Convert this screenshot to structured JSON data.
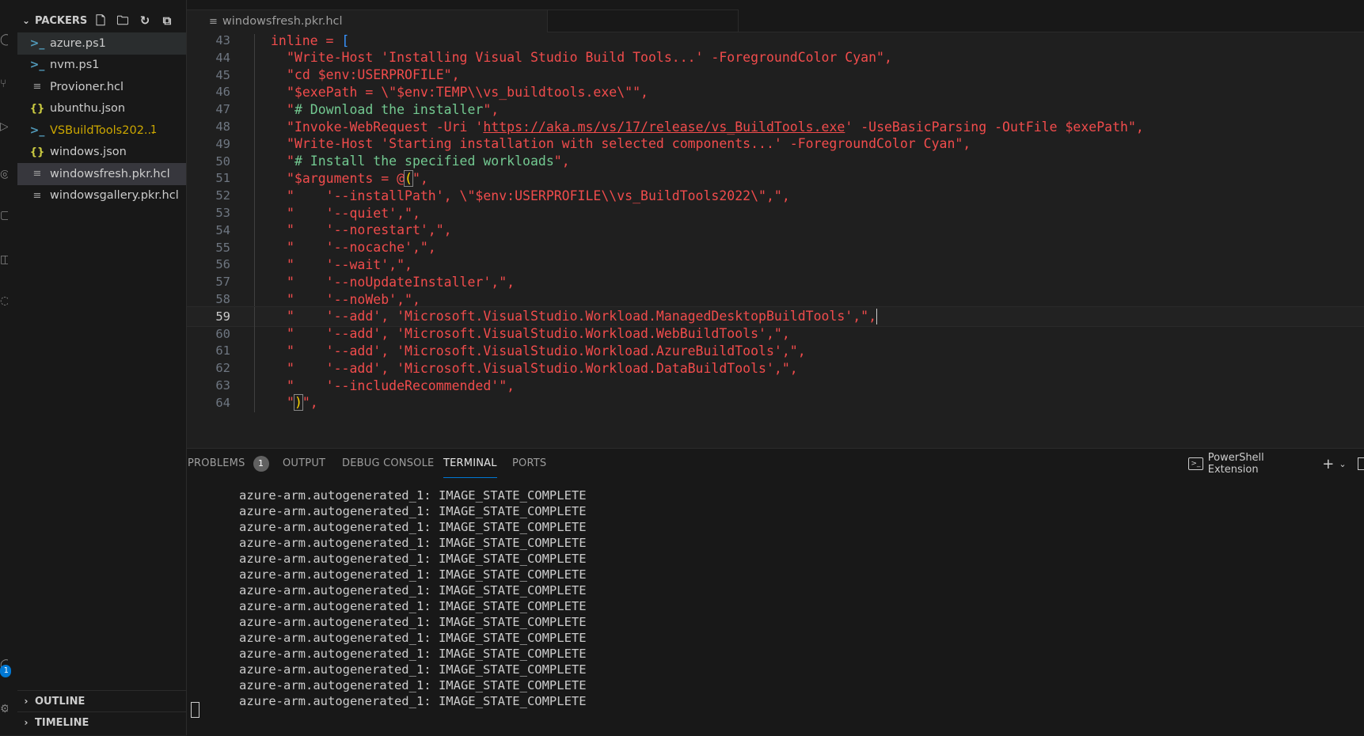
{
  "sidebar": {
    "title": "PACKERS",
    "files": [
      {
        "name": "azure.ps1",
        "type": "ps",
        "state": "active"
      },
      {
        "name": "nvm.ps1",
        "type": "ps",
        "state": ""
      },
      {
        "name": "Provioner.hcl",
        "type": "hcl",
        "state": ""
      },
      {
        "name": "ubunthu.json",
        "type": "json",
        "state": ""
      },
      {
        "name": "VSBuildTools202...",
        "type": "ps",
        "state": "warn",
        "badge": "1"
      },
      {
        "name": "windows.json",
        "type": "json",
        "state": ""
      },
      {
        "name": "windowsfresh.pkr.hcl",
        "type": "hcl",
        "state": "selected"
      },
      {
        "name": "windowsgallery.pkr.hcl",
        "type": "hcl",
        "state": ""
      }
    ],
    "outline": "OUTLINE",
    "timeline": "TIMELINE"
  },
  "activity": {
    "badge": "1"
  },
  "editor": {
    "tab_label": "windowsfresh.pkr.hcl",
    "current_line": 59,
    "lines": [
      {
        "n": 43,
        "parts": [
          [
            "kw",
            "inline = "
          ],
          [
            "b",
            "["
          ]
        ],
        "indent": 0
      },
      {
        "n": 44,
        "parts": [
          [
            "r",
            "\"Write-Host 'Installing Visual Studio Build Tools...' -ForegroundColor Cyan\","
          ]
        ],
        "indent": 1
      },
      {
        "n": 45,
        "parts": [
          [
            "r",
            "\"cd $env:USERPROFILE\","
          ]
        ],
        "indent": 1
      },
      {
        "n": 46,
        "parts": [
          [
            "r",
            "\"$exePath = \\\"$env:TEMP\\\\vs_buildtools.exe\\\"\","
          ]
        ],
        "indent": 1
      },
      {
        "n": 47,
        "parts": [
          [
            "r",
            "\""
          ],
          [
            "g",
            "# Download the installer"
          ],
          [
            "r",
            "\","
          ]
        ],
        "indent": 1
      },
      {
        "n": 48,
        "parts": [
          [
            "r",
            "\"Invoke-WebRequest -Uri '"
          ],
          [
            "u",
            "https://aka.ms/vs/17/release/vs_BuildTools.exe"
          ],
          [
            "r",
            "' -UseBasicParsing -OutFile $exePath\","
          ]
        ],
        "indent": 1
      },
      {
        "n": 49,
        "parts": [
          [
            "r",
            "\"Write-Host 'Starting installation with selected components...' -ForegroundColor Cyan\","
          ]
        ],
        "indent": 1
      },
      {
        "n": 50,
        "parts": [
          [
            "r",
            "\""
          ],
          [
            "g",
            "# Install the specified workloads"
          ],
          [
            "r",
            "\","
          ]
        ],
        "indent": 1
      },
      {
        "n": 51,
        "parts": [
          [
            "r",
            "\"$arguments = @"
          ],
          [
            "k",
            "("
          ],
          [
            "r",
            "\","
          ]
        ],
        "indent": 1
      },
      {
        "n": 52,
        "parts": [
          [
            "r",
            "\"    '--installPath', \\\"$env:USERPROFILE\\\\vs_BuildTools2022\\\",\","
          ]
        ],
        "indent": 1
      },
      {
        "n": 53,
        "parts": [
          [
            "r",
            "\"    '--quiet',\","
          ]
        ],
        "indent": 1
      },
      {
        "n": 54,
        "parts": [
          [
            "r",
            "\"    '--norestart',\","
          ]
        ],
        "indent": 1
      },
      {
        "n": 55,
        "parts": [
          [
            "r",
            "\"    '--nocache',\","
          ]
        ],
        "indent": 1
      },
      {
        "n": 56,
        "parts": [
          [
            "r",
            "\"    '--wait',\","
          ]
        ],
        "indent": 1
      },
      {
        "n": 57,
        "parts": [
          [
            "r",
            "\"    '--noUpdateInstaller',\","
          ]
        ],
        "indent": 1
      },
      {
        "n": 58,
        "parts": [
          [
            "r",
            "\"    '--noWeb',\","
          ]
        ],
        "indent": 1
      },
      {
        "n": 59,
        "parts": [
          [
            "r",
            "\"    '--add', 'Microsoft.VisualStudio.Workload.ManagedDesktopBuildTools',\","
          ],
          [
            "c",
            ""
          ]
        ],
        "indent": 1
      },
      {
        "n": 60,
        "parts": [
          [
            "r",
            "\"    '--add', 'Microsoft.VisualStudio.Workload.WebBuildTools',\","
          ]
        ],
        "indent": 1
      },
      {
        "n": 61,
        "parts": [
          [
            "r",
            "\"    '--add', 'Microsoft.VisualStudio.Workload.AzureBuildTools',\","
          ]
        ],
        "indent": 1
      },
      {
        "n": 62,
        "parts": [
          [
            "r",
            "\"    '--add', 'Microsoft.VisualStudio.Workload.DataBuildTools',\","
          ]
        ],
        "indent": 1
      },
      {
        "n": 63,
        "parts": [
          [
            "r",
            "\"    '--includeRecommended'\","
          ]
        ],
        "indent": 1
      },
      {
        "n": 64,
        "parts": [
          [
            "r",
            "\""
          ],
          [
            "k",
            ")"
          ],
          [
            "r",
            "\","
          ]
        ],
        "indent": 1
      }
    ]
  },
  "panel": {
    "tabs": [
      {
        "label": "PROBLEMS",
        "badge": "1"
      },
      {
        "label": "OUTPUT"
      },
      {
        "label": "DEBUG CONSOLE"
      },
      {
        "label": "TERMINAL",
        "active": true
      },
      {
        "label": "PORTS"
      }
    ],
    "shell_label": "PowerShell Extension",
    "terminal_lines": [
      "azure-arm.autogenerated_1: IMAGE_STATE_COMPLETE",
      "azure-arm.autogenerated_1: IMAGE_STATE_COMPLETE",
      "azure-arm.autogenerated_1: IMAGE_STATE_COMPLETE",
      "azure-arm.autogenerated_1: IMAGE_STATE_COMPLETE",
      "azure-arm.autogenerated_1: IMAGE_STATE_COMPLETE",
      "azure-arm.autogenerated_1: IMAGE_STATE_COMPLETE",
      "azure-arm.autogenerated_1: IMAGE_STATE_COMPLETE",
      "azure-arm.autogenerated_1: IMAGE_STATE_COMPLETE",
      "azure-arm.autogenerated_1: IMAGE_STATE_COMPLETE",
      "azure-arm.autogenerated_1: IMAGE_STATE_COMPLETE",
      "azure-arm.autogenerated_1: IMAGE_STATE_COMPLETE",
      "azure-arm.autogenerated_1: IMAGE_STATE_COMPLETE",
      "azure-arm.autogenerated_1: IMAGE_STATE_COMPLETE",
      "azure-arm.autogenerated_1: IMAGE_STATE_COMPLETE"
    ]
  }
}
